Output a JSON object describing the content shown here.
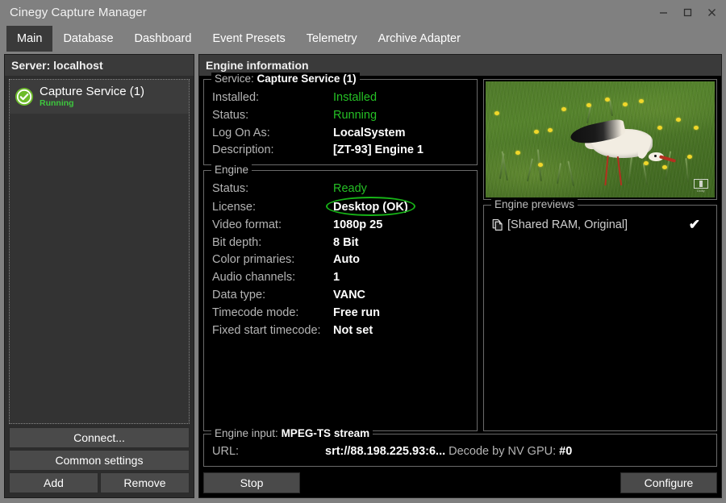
{
  "window": {
    "title": "Cinegy Capture Manager",
    "minimize_label": "–",
    "maximize_label": "□",
    "close_label": "✕"
  },
  "tabs": [
    {
      "label": "Main",
      "active": true
    },
    {
      "label": "Database",
      "active": false
    },
    {
      "label": "Dashboard",
      "active": false
    },
    {
      "label": "Event Presets",
      "active": false
    },
    {
      "label": "Telemetry",
      "active": false
    },
    {
      "label": "Archive Adapter",
      "active": false
    }
  ],
  "sidebar": {
    "header": "Server: localhost",
    "service": {
      "name": "Capture Service (1)",
      "state": "Running",
      "status_icon": "green-check-circle-icon"
    },
    "buttons": {
      "connect": "Connect...",
      "common_settings": "Common settings",
      "add": "Add",
      "remove": "Remove"
    }
  },
  "main": {
    "header": "Engine information",
    "service_group": {
      "title_prefix": "Service: ",
      "title_value": "Capture Service (1)",
      "rows": [
        {
          "key": "Installed:",
          "value": "Installed",
          "style": "green"
        },
        {
          "key": "Status:",
          "value": "Running",
          "style": "green"
        },
        {
          "key": "Log On As:",
          "value": "LocalSystem",
          "style": "normal"
        },
        {
          "key": "Description:",
          "value": "[ZT-93] Engine 1",
          "style": "normal"
        }
      ]
    },
    "engine_group": {
      "title": "Engine",
      "rows": [
        {
          "key": "Status:",
          "value": "Ready",
          "style": "green"
        },
        {
          "key": "License:",
          "value": "Desktop (OK)",
          "style": "normal",
          "highlight": true
        },
        {
          "key": "Video format:",
          "value": "1080p 25",
          "style": "normal"
        },
        {
          "key": "Bit depth:",
          "value": "8 Bit",
          "style": "normal"
        },
        {
          "key": "Color primaries:",
          "value": "Auto",
          "style": "normal"
        },
        {
          "key": "Audio channels:",
          "value": "1",
          "style": "normal"
        },
        {
          "key": "Data type:",
          "value": "VANC",
          "style": "normal"
        },
        {
          "key": "Timecode mode:",
          "value": "Free run",
          "style": "normal"
        },
        {
          "key": "Fixed start timecode:",
          "value": "Not set",
          "style": "normal"
        }
      ]
    },
    "video_preview": {
      "name": "video-preview",
      "watermark": "Dolby",
      "watermark_sub": "DIGITAL"
    },
    "previews_group": {
      "title": "Engine previews",
      "items": [
        {
          "icon": "copy-pages-icon",
          "label": "[Shared RAM, Original]",
          "check": "✔"
        }
      ]
    },
    "input_group": {
      "title_prefix": "Engine input: ",
      "title_value": "MPEG-TS stream",
      "url_key": "URL:",
      "url_value": "srt://88.198.225.93:6...",
      "decode_key": "Decode by NV GPU:",
      "decode_value": "#0"
    },
    "buttons": {
      "stop": "Stop",
      "configure": "Configure"
    }
  },
  "colors": {
    "accent_green": "#25c025",
    "highlight_ellipse": "#17b317",
    "chrome": "#808080",
    "panel": "#2d2d2d"
  }
}
